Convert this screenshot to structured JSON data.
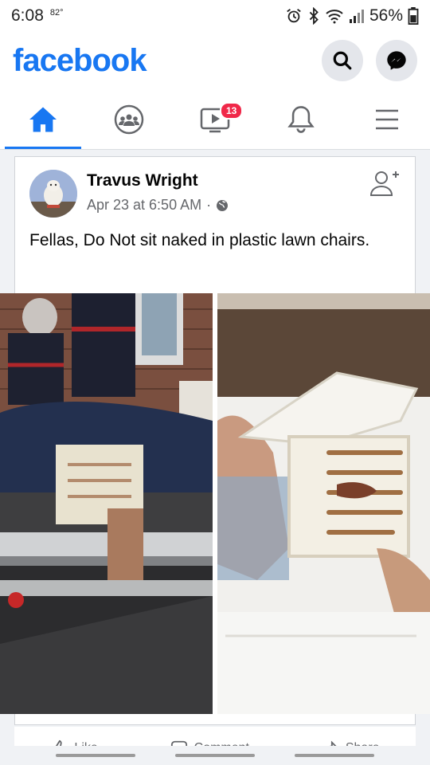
{
  "status": {
    "time": "6:08",
    "temperature": "82°",
    "battery": "56%"
  },
  "header": {
    "brand": "facebook",
    "icons": [
      "search-icon",
      "messenger-icon"
    ]
  },
  "tabs": [
    {
      "name": "home",
      "icon": "home-icon",
      "active": true
    },
    {
      "name": "groups",
      "icon": "groups-icon",
      "active": false
    },
    {
      "name": "watch",
      "icon": "video-icon",
      "active": false,
      "badge": "13"
    },
    {
      "name": "notifications",
      "icon": "bell-icon",
      "active": false
    },
    {
      "name": "menu",
      "icon": "menu-icon",
      "active": false
    }
  ],
  "post": {
    "author": "Travus Wright",
    "timestamp": "Apr 23 at 6:50 AM",
    "separator": "·",
    "text": "Fellas, Do Not sit naked in plastic lawn chairs."
  },
  "actions": {
    "like": "Like",
    "comment": "Comment",
    "share": "Share"
  },
  "colors": {
    "brand": "#1877f2",
    "badge": "#f02849"
  }
}
